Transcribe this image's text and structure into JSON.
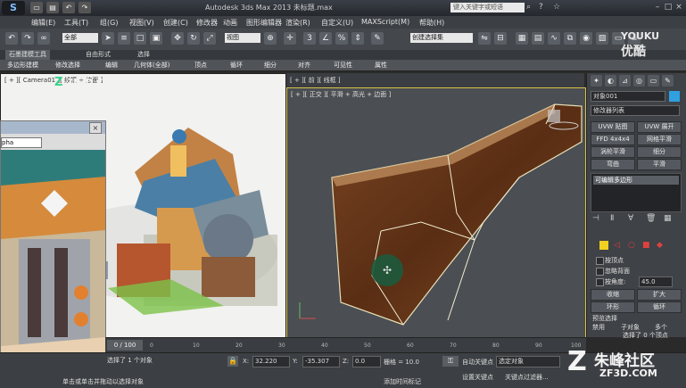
{
  "titlebar": {
    "title": "Autodesk 3ds Max 2013  未标题.max",
    "search_placeholder": "键入关键字或短语",
    "minimize": "–",
    "maximize": "□",
    "close": "×"
  },
  "menu": [
    "编辑(E)",
    "工具(T)",
    "组(G)",
    "视图(V)",
    "创建(C)",
    "修改器",
    "动画",
    "图形编辑器",
    "渲染(R)",
    "自定义(U)",
    "MAXScript(M)",
    "帮助(H)"
  ],
  "toolbar": {
    "selection_filter": "全部",
    "ref_coord": "视图",
    "named_selection": "创建选择集"
  },
  "ribbon_tabs": [
    "石墨建模工具",
    "自由形式",
    "选择"
  ],
  "ribbon_items": [
    "多边形建模",
    "修改选择",
    "编辑",
    "几何体(全部)",
    "顶点",
    "循环",
    "细分",
    "对齐",
    "可见性",
    "属性"
  ],
  "viewport_left": {
    "label": "[ + ][ Camera01 ][ 线框 + 边面 ]"
  },
  "viewport_right_top": {
    "label": "[ + ][ 前 ][ 线框 ]"
  },
  "viewport_right": {
    "label": "[ + ][ 正交 ][ 平滑 + 高光 + 边面 ]"
  },
  "float_window": {
    "select_value": "pha",
    "close": "×"
  },
  "cmdpanel": {
    "object_name": "对象001",
    "modifier_list": "修改器列表",
    "buttons": [
      "UVW 贴图",
      "UVW 展开",
      "FFD 4x4x4",
      "网格平滑",
      "涡轮平滑",
      "细分",
      "弯曲",
      "平滑"
    ],
    "stack_item": "可编辑多边形",
    "checks": [
      "按顶点",
      "忽略背面",
      "按角度:"
    ],
    "angle_value": "45.0",
    "shrink": "收缩",
    "grow": "扩大",
    "ring": "环形",
    "loop": "循环",
    "preview_label": "预览选择",
    "radios": [
      "禁用",
      "子对象",
      "多个"
    ],
    "selected_count": "选择了 0 个顶点"
  },
  "timeline": {
    "frame": "0 / 100",
    "ticks": [
      "0",
      "10",
      "20",
      "30",
      "40",
      "50",
      "60",
      "70",
      "80",
      "90",
      "100"
    ]
  },
  "statusbar": {
    "selection_info": "选择了 1 个对象",
    "prompt": "单击或单击并拖动以选择对象",
    "add_time_tag": "添加时间标记",
    "x_label": "X:",
    "x_value": "32.220",
    "y_label": "Y:",
    "y_value": "-35.307",
    "z_label": "Z:",
    "z_value": "0.0",
    "grid": "栅格 = 10.0",
    "autokey": "自动关键点",
    "selected_obj": "选定对象",
    "setkey": "设置关键点",
    "key_filters": "关键点过滤器..."
  },
  "watermarks": {
    "youku_en": "YOUKU",
    "youku_cn": "优酷",
    "zf3d_top": "ZF3D.COM",
    "zhufeng_cn": "朱峰社区",
    "zhufeng_en": "ZF3D.COM"
  },
  "colors": {
    "viewport_border_active": "#d8c24a",
    "wood": "#6b3a1c",
    "selection_dot": "#1d5a3c"
  }
}
